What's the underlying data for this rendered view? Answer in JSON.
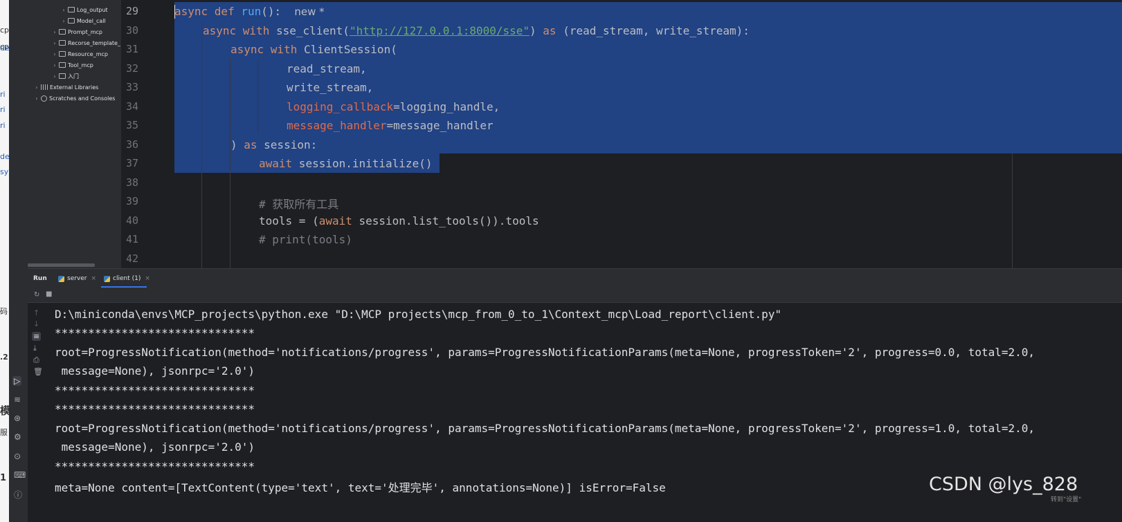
{
  "left_strip": {
    "fragments": [
      {
        "text": "cp"
      },
      {
        "text": "cp"
      },
      {
        "text": "de"
      },
      {
        "text": "ri"
      },
      {
        "text": "ri"
      },
      {
        "text": "ri"
      },
      {
        "text": "de"
      },
      {
        "text": "sy"
      },
      {
        "text": "码"
      },
      {
        "text": ".2"
      },
      {
        "text": "模"
      },
      {
        "text": "服"
      },
      {
        "text": "1"
      }
    ]
  },
  "project_tree": {
    "items": [
      {
        "label": "Log_output",
        "icon": "folder-icon"
      },
      {
        "label": "Model_call",
        "icon": "folder-icon"
      },
      {
        "label": "Prompt_mcp",
        "icon": "folder-icon"
      },
      {
        "label": "Recorse_template_",
        "icon": "folder-icon"
      },
      {
        "label": "Resource_mcp",
        "icon": "folder-icon"
      },
      {
        "label": "Tool_mcp",
        "icon": "folder-icon"
      },
      {
        "label": "入门",
        "icon": "folder-icon"
      },
      {
        "label": "External Libraries",
        "icon": "library-icon"
      },
      {
        "label": "Scratches and Consoles",
        "icon": "scratches-icon"
      }
    ]
  },
  "editor": {
    "line_numbers": [
      "29",
      "30",
      "31",
      "32",
      "33",
      "34",
      "35",
      "36",
      "37",
      "38",
      "39",
      "40",
      "41",
      "42"
    ],
    "code": {
      "l29_kw": "async def ",
      "l29_fn": "run",
      "l29_rest": "():",
      "l29_hint": "new *",
      "l30_kw1": "async with ",
      "l30_a": "sse_client(",
      "l30_str": "\"http://127.0.0.1:8000/sse\"",
      "l30_b": ") ",
      "l30_kw2": "as",
      "l30_c": " (read_stream, write_stream):",
      "l31_kw": "async with ",
      "l31_rest": "ClientSession(",
      "l32": "read_stream,",
      "l33": "write_stream,",
      "l34_param": "logging_callback",
      "l34_rest": "=logging_handle,",
      "l35_param": "message_handler",
      "l35_rest": "=message_handler",
      "l36_a": ") ",
      "l36_kw": "as",
      "l36_b": " session:",
      "l37_kw": "await",
      "l37_rest": " session.initialize()",
      "l39_cm": "# 获取所有工具",
      "l40_a": "tools = (",
      "l40_kw": "await",
      "l40_b": " session.list_tools()).tools",
      "l41_cm": "# print(tools)"
    },
    "colors": {
      "selection": "#214283",
      "keyword": "#cf8e6d",
      "function": "#56a8f5",
      "string": "#6aab73",
      "parameter": "#e06c4a",
      "comment": "#7a7e85"
    }
  },
  "run_panel": {
    "label": "Run",
    "tabs": [
      {
        "label": "server",
        "icon": "python-icon",
        "close": "×"
      },
      {
        "label": "client (1)",
        "icon": "python-icon",
        "close": "×"
      }
    ],
    "console": [
      "D:\\miniconda\\envs\\MCP_projects\\python.exe \"D:\\MCP projects\\mcp_from_0_to_1\\Context_mcp\\Load_report\\client.py\"",
      "******************************",
      "root=ProgressNotification(method='notifications/progress', params=ProgressNotificationParams(meta=None, progressToken='2', progress=0.0, total=2.0,",
      " message=None), jsonrpc='2.0')",
      "******************************",
      "******************************",
      "root=ProgressNotification(method='notifications/progress', params=ProgressNotificationParams(meta=None, progressToken='2', progress=1.0, total=2.0,",
      " message=None), jsonrpc='2.0')",
      "******************************",
      "meta=None content=[TextContent(type='text', text='处理完毕', annotations=None)] isError=False"
    ]
  },
  "watermark": "CSDN @lys_828",
  "activate_hint": "转到\"设置\""
}
